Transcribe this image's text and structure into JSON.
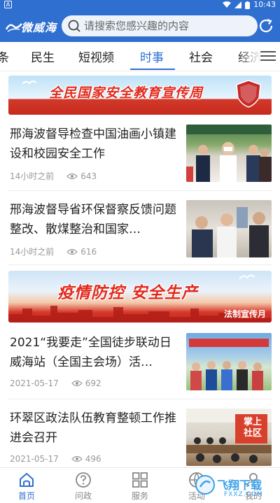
{
  "status_bar": {
    "sim_label": "A",
    "time": "10:43"
  },
  "header": {
    "logo_text": "微威海",
    "search_placeholder": "请搜索您感兴趣的内容"
  },
  "tabs": [
    "条",
    "民生",
    "短视频",
    "时事",
    "社会",
    "经济"
  ],
  "active_tab": "时事",
  "banners": [
    {
      "title": "全民国家安全教育宣传周",
      "badge": "国家安全"
    },
    {
      "title": "疫情防控 安全生产",
      "subtitle": "法制宣传月"
    }
  ],
  "news": [
    {
      "title": "邢海波督导检查中国油画小镇建设和校园安全工作",
      "time": "14小时之前",
      "views": "643"
    },
    {
      "title": "邢海波督导省环保督察反馈问题整改、散煤整治和国家…",
      "time": "14小时之前",
      "views": "616"
    },
    {
      "title": "2021“我要走”全国徒步联动日威海站（全国主会场）活…",
      "time": "2021-05-17",
      "views": "692"
    },
    {
      "title": "环翠区政法队伍教育整顿工作推进会召开",
      "time": "2021-05-17",
      "views": "496",
      "thumb_text": "掌上社区"
    }
  ],
  "bottom_nav": [
    {
      "label": "首页",
      "icon": "home-icon",
      "active": true
    },
    {
      "label": "问政",
      "icon": "question-icon",
      "active": false
    },
    {
      "label": "服务",
      "icon": "grid-icon",
      "active": false
    },
    {
      "label": "活动",
      "icon": "basketball-icon",
      "active": false
    },
    {
      "label": "我的",
      "icon": "user-icon",
      "active": false
    }
  ],
  "watermark": {
    "text": "飞翔下载",
    "sub": "FXXZ.COM"
  },
  "colors": {
    "brand": "#2f6fd0",
    "banner_red": "#e12a1d",
    "meta_gray": "#999999"
  }
}
